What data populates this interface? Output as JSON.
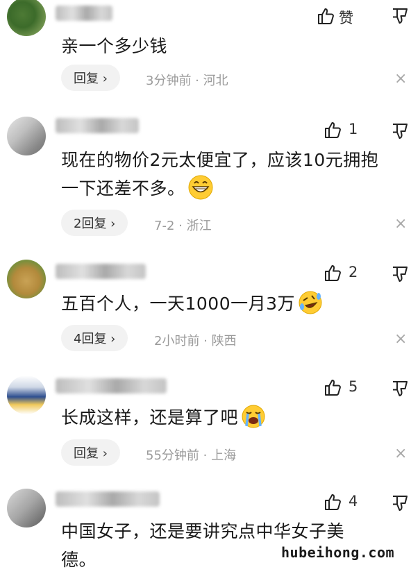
{
  "comments": [
    {
      "text": "亲一个多少钱",
      "reply_label": "回复 ›",
      "meta": "3分钟前 · 河北",
      "like_label": "赞",
      "close_label": "×"
    },
    {
      "text_line1": "现在的物价2元太便宜了，应该10元拥抱",
      "text_line2": "一下还差不多。",
      "reply_label": "2回复 ›",
      "meta": "7-2 · 浙江",
      "like_count": "1",
      "close_label": "×",
      "emoji": "grinning-face"
    },
    {
      "text": "五百个人，一天1000一月3万",
      "reply_label": "4回复 ›",
      "meta": "2小时前 · 陕西",
      "like_count": "2",
      "close_label": "×",
      "emoji": "rolling-laughing-face"
    },
    {
      "text": "长成这样，还是算了吧",
      "reply_label": "回复 ›",
      "meta": "55分钟前 · 上海",
      "like_count": "5",
      "close_label": "×",
      "emoji": "loudly-crying-face"
    },
    {
      "text_line1": "中国女子，还是要讲究点中华女子美",
      "text_line2": "德。",
      "like_count": "4"
    }
  ],
  "watermark": "hubeihong.com"
}
